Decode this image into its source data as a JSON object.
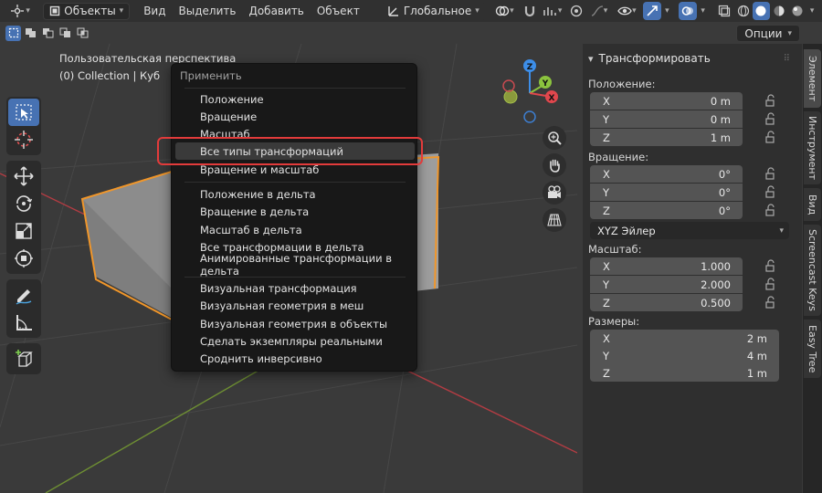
{
  "header": {
    "objects_mode": "Объекты",
    "menu": [
      "Вид",
      "Выделить",
      "Добавить",
      "Объект"
    ],
    "orientation": "Глобальное",
    "options": "Опции"
  },
  "viewport": {
    "perspective_label": "Пользовательская перспектива",
    "collection_label": "(0) Collection | Куб",
    "axis_labels": {
      "x": "X",
      "y": "Y",
      "z": "Z"
    }
  },
  "menu": {
    "title": "Применить",
    "items": [
      "Положение",
      "Вращение",
      "Масштаб",
      "Все типы трансформаций",
      "Вращение и масштаб",
      "Положение в дельта",
      "Вращение в дельта",
      "Масштаб в дельта",
      "Все трансформации в дельта",
      "Анимированные трансформации в дельта",
      "Визуальная трансформация",
      "Визуальная геометрия в меш",
      "Визуальная геометрия в объекты",
      "Сделать экземпляры реальными",
      "Сроднить инверсивно"
    ],
    "highlighted_index": 3
  },
  "panel": {
    "title": "Трансформировать",
    "location_label": "Положение:",
    "location": [
      {
        "axis": "X",
        "value": "0 m"
      },
      {
        "axis": "Y",
        "value": "0 m"
      },
      {
        "axis": "Z",
        "value": "1 m"
      }
    ],
    "rotation_label": "Вращение:",
    "rotation": [
      {
        "axis": "X",
        "value": "0°"
      },
      {
        "axis": "Y",
        "value": "0°"
      },
      {
        "axis": "Z",
        "value": "0°"
      }
    ],
    "rotation_mode": "XYZ Эйлер",
    "scale_label": "Масштаб:",
    "scale": [
      {
        "axis": "X",
        "value": "1.000"
      },
      {
        "axis": "Y",
        "value": "2.000"
      },
      {
        "axis": "Z",
        "value": "0.500"
      }
    ],
    "dimensions_label": "Размеры:",
    "dimensions": [
      {
        "axis": "X",
        "value": "2 m"
      },
      {
        "axis": "Y",
        "value": "4 m"
      },
      {
        "axis": "Z",
        "value": "1 m"
      }
    ]
  },
  "tabs": [
    "Элемент",
    "Инструмент",
    "Вид",
    "Screencast Keys",
    "Easy Tree"
  ],
  "colors": {
    "accent": "#4772b3",
    "highlight_border": "#e23b3b",
    "selection_outline": "#f0962a",
    "axis_x": "#e0474d",
    "axis_y": "#8bc33e",
    "axis_z": "#3d8ee8"
  }
}
